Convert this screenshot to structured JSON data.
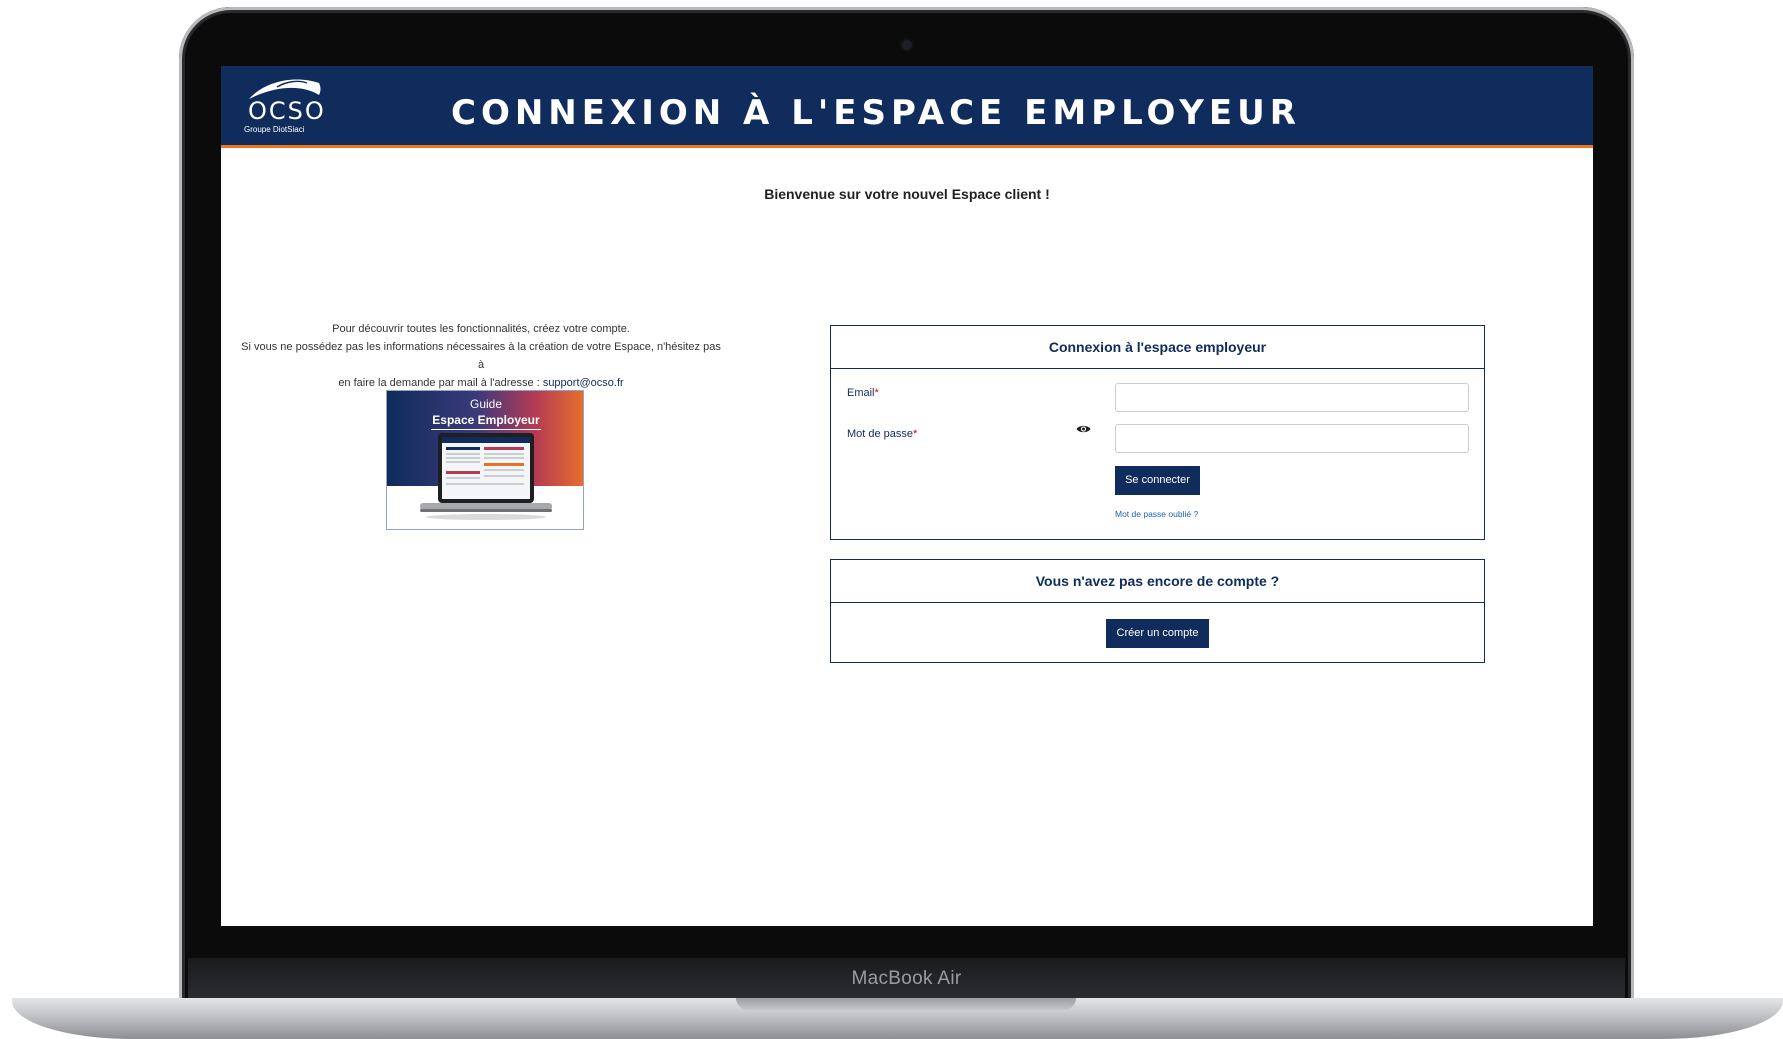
{
  "device": {
    "label": "MacBook Air"
  },
  "header": {
    "logo_text": "OCSO",
    "logo_subtext": "Groupe DiotSiaci",
    "title": "CONNEXION À L'ESPACE EMPLOYEUR"
  },
  "welcome": "Bienvenue sur votre nouvel Espace client !",
  "info": {
    "line1": "Pour découvrir toutes les fonctionnalités, créez votre compte.",
    "line2": "Si vous ne possédez pas les informations nécessaires à la création de votre Espace, n'hésitez pas à",
    "line3_prefix": "en faire la demande par mail à l'adresse : ",
    "support_email": "support@ocso.fr"
  },
  "guide": {
    "title_line1": "Guide",
    "title_line2": "Espace Employeur"
  },
  "login_card": {
    "title": "Connexion à l'espace employeur",
    "email_label": "Email",
    "password_label": "Mot de passe",
    "required_marker": "*",
    "email_value": "",
    "password_value": "",
    "submit_label": "Se connecter",
    "forgot_label": "Mot de passe oublié ?"
  },
  "create_card": {
    "title": "Vous n'avez pas encore de compte ?",
    "button_label": "Créer un compte"
  },
  "colors": {
    "brand_navy": "#0f2c5c",
    "accent_orange": "#e87722",
    "required_red": "#d0021b"
  },
  "icons": [
    "eye-icon",
    "ocso-logo-swoosh-icon",
    "guide-laptop-icon"
  ]
}
